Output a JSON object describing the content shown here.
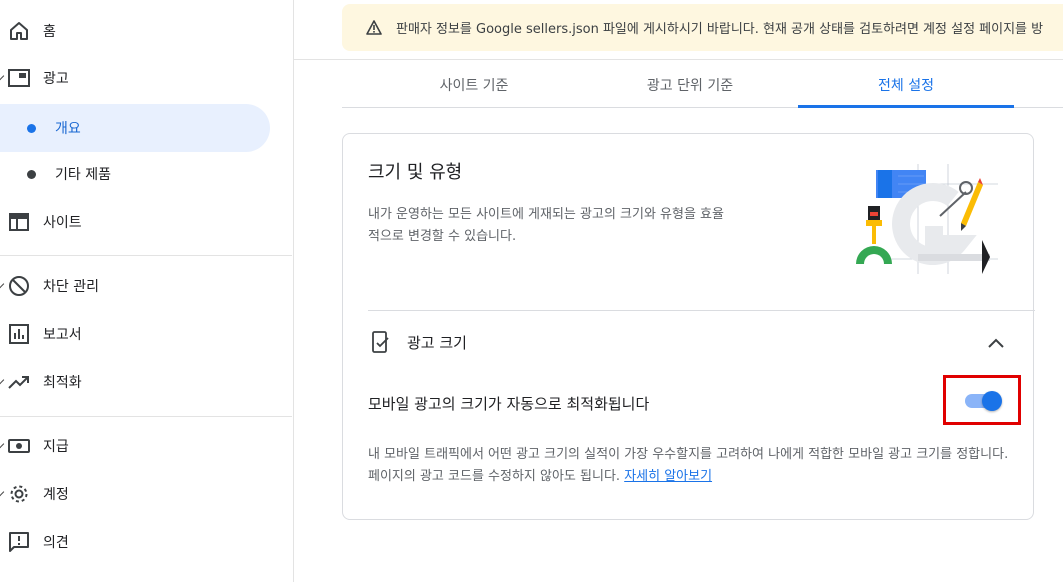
{
  "sidebar": {
    "items": [
      {
        "label": "홈",
        "icon": "home-icon"
      },
      {
        "label": "광고",
        "icon": "ads-icon"
      },
      {
        "label": "개요",
        "active": true
      },
      {
        "label": "기타 제품"
      },
      {
        "label": "사이트",
        "icon": "sites-icon"
      },
      {
        "label": "차단 관리",
        "icon": "block-icon"
      },
      {
        "label": "보고서",
        "icon": "reports-icon"
      },
      {
        "label": "최적화",
        "icon": "trending-up-icon"
      },
      {
        "label": "지급",
        "icon": "payments-icon"
      },
      {
        "label": "계정",
        "icon": "gear-icon"
      },
      {
        "label": "의견",
        "icon": "feedback-icon"
      }
    ]
  },
  "banner": {
    "text": "판매자 정보를 Google sellers.json 파일에 게시하시기 바랍니다. 현재 공개 상태를 검토하려면 계정 설정 페이지를 방"
  },
  "tabs": [
    {
      "label": "사이트 기준"
    },
    {
      "label": "광고 단위 기준"
    },
    {
      "label": "전체 설정",
      "active": true
    }
  ],
  "card": {
    "title": "크기 및 유형",
    "description": "내가 운영하는 모든 사이트에 게재되는 광고의 크기와 유형을 효율적으로 변경할 수 있습니다.",
    "section": {
      "title": "광고 크기",
      "toggle_label": "모바일 광고의 크기가 자동으로 최적화됩니다",
      "toggle_on": true,
      "description": "내 모바일 트래픽에서 어떤 광고 크기의 실적이 가장 우수할지를 고려하여 나에게 적합한 모바일 광고 크기를 정합니다. 페이지의 광고 코드를 수정하지 않아도 됩니다.",
      "link_label": "자세히 알아보기"
    }
  },
  "colors": {
    "accent": "#1a73e8",
    "highlight": "#e00000",
    "banner_bg": "#fef7e0"
  }
}
